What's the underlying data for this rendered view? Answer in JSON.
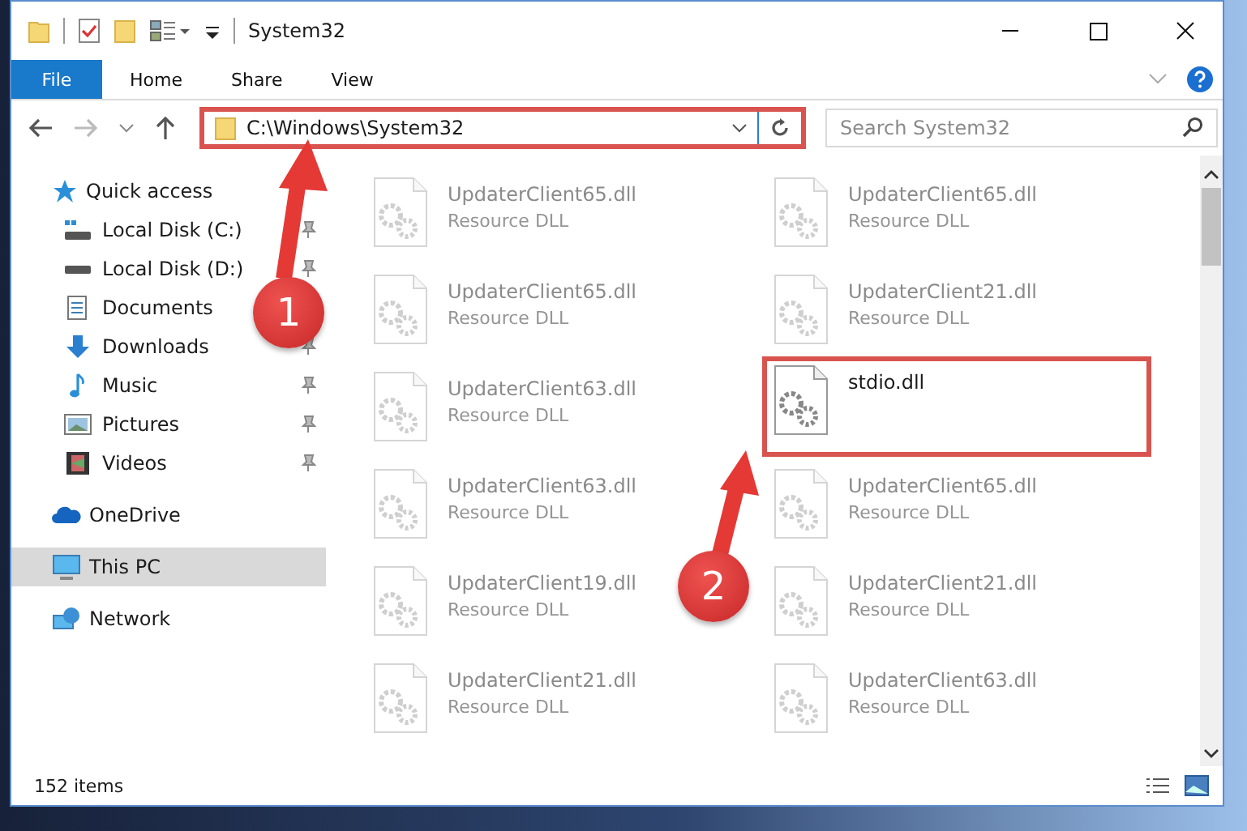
{
  "window": {
    "title": "System32"
  },
  "ribbon_tabs": [
    {
      "label": "File",
      "kind": "file"
    },
    {
      "label": "Home",
      "kind": "tab"
    },
    {
      "label": "Share",
      "kind": "tab"
    },
    {
      "label": "View",
      "kind": "tab"
    }
  ],
  "address_bar": {
    "path": "C:\\Windows\\System32",
    "highlighted": true
  },
  "search": {
    "placeholder": "Search System32"
  },
  "sidebar": {
    "items": [
      {
        "label": "Quick access",
        "kind": "star",
        "selected": false,
        "children": [
          {
            "label": "Local Disk (C:)",
            "kind": "system-drive",
            "pinned": true
          },
          {
            "label": "Local Disk (D:)",
            "kind": "drive",
            "pinned": true
          },
          {
            "label": "Documents",
            "kind": "documents"
          },
          {
            "label": "Downloads",
            "kind": "downloads",
            "pinned": true
          },
          {
            "label": "Music",
            "kind": "music",
            "pinned": true
          },
          {
            "label": "Pictures",
            "kind": "pictures",
            "pinned": true
          },
          {
            "label": "Videos",
            "kind": "videos",
            "pinned": true
          }
        ]
      },
      {
        "label": "OneDrive",
        "kind": "cloud",
        "selected": false
      },
      {
        "label": "This PC",
        "kind": "pc",
        "selected": true
      },
      {
        "label": "Network",
        "kind": "network",
        "selected": false
      }
    ]
  },
  "files": [
    {
      "name": "UpdaterClient65.dll",
      "type": "Resource DLL",
      "blurred": true,
      "highlighted": false
    },
    {
      "name": "UpdaterClient65.dll",
      "type": "Resource DLL",
      "blurred": true,
      "highlighted": false
    },
    {
      "name": "UpdaterClient65.dll",
      "type": "Resource DLL",
      "blurred": true,
      "highlighted": false
    },
    {
      "name": "UpdaterClient21.dll",
      "type": "Resource DLL",
      "blurred": true,
      "highlighted": false
    },
    {
      "name": "UpdaterClient63.dll",
      "type": "Resource DLL",
      "blurred": true,
      "highlighted": false
    },
    {
      "name": "stdio.dll",
      "blurred": false,
      "highlighted": true
    },
    {
      "name": "UpdaterClient63.dll",
      "type": "Resource DLL",
      "blurred": true,
      "highlighted": false
    },
    {
      "name": "UpdaterClient65.dll",
      "type": "Resource DLL",
      "blurred": true,
      "highlighted": false
    },
    {
      "name": "UpdaterClient19.dll",
      "type": "Resource DLL",
      "blurred": true,
      "highlighted": false
    },
    {
      "name": "UpdaterClient21.dll",
      "type": "Resource DLL",
      "blurred": true,
      "highlighted": false
    },
    {
      "name": "UpdaterClient21.dll",
      "type": "Resource DLL",
      "blurred": true,
      "highlighted": false
    },
    {
      "name": "UpdaterClient63.dll",
      "type": "Resource DLL",
      "blurred": true,
      "highlighted": false
    }
  ],
  "annotations": [
    {
      "number": "1"
    },
    {
      "number": "2"
    }
  ],
  "status_bar": {
    "count": "152 items"
  }
}
